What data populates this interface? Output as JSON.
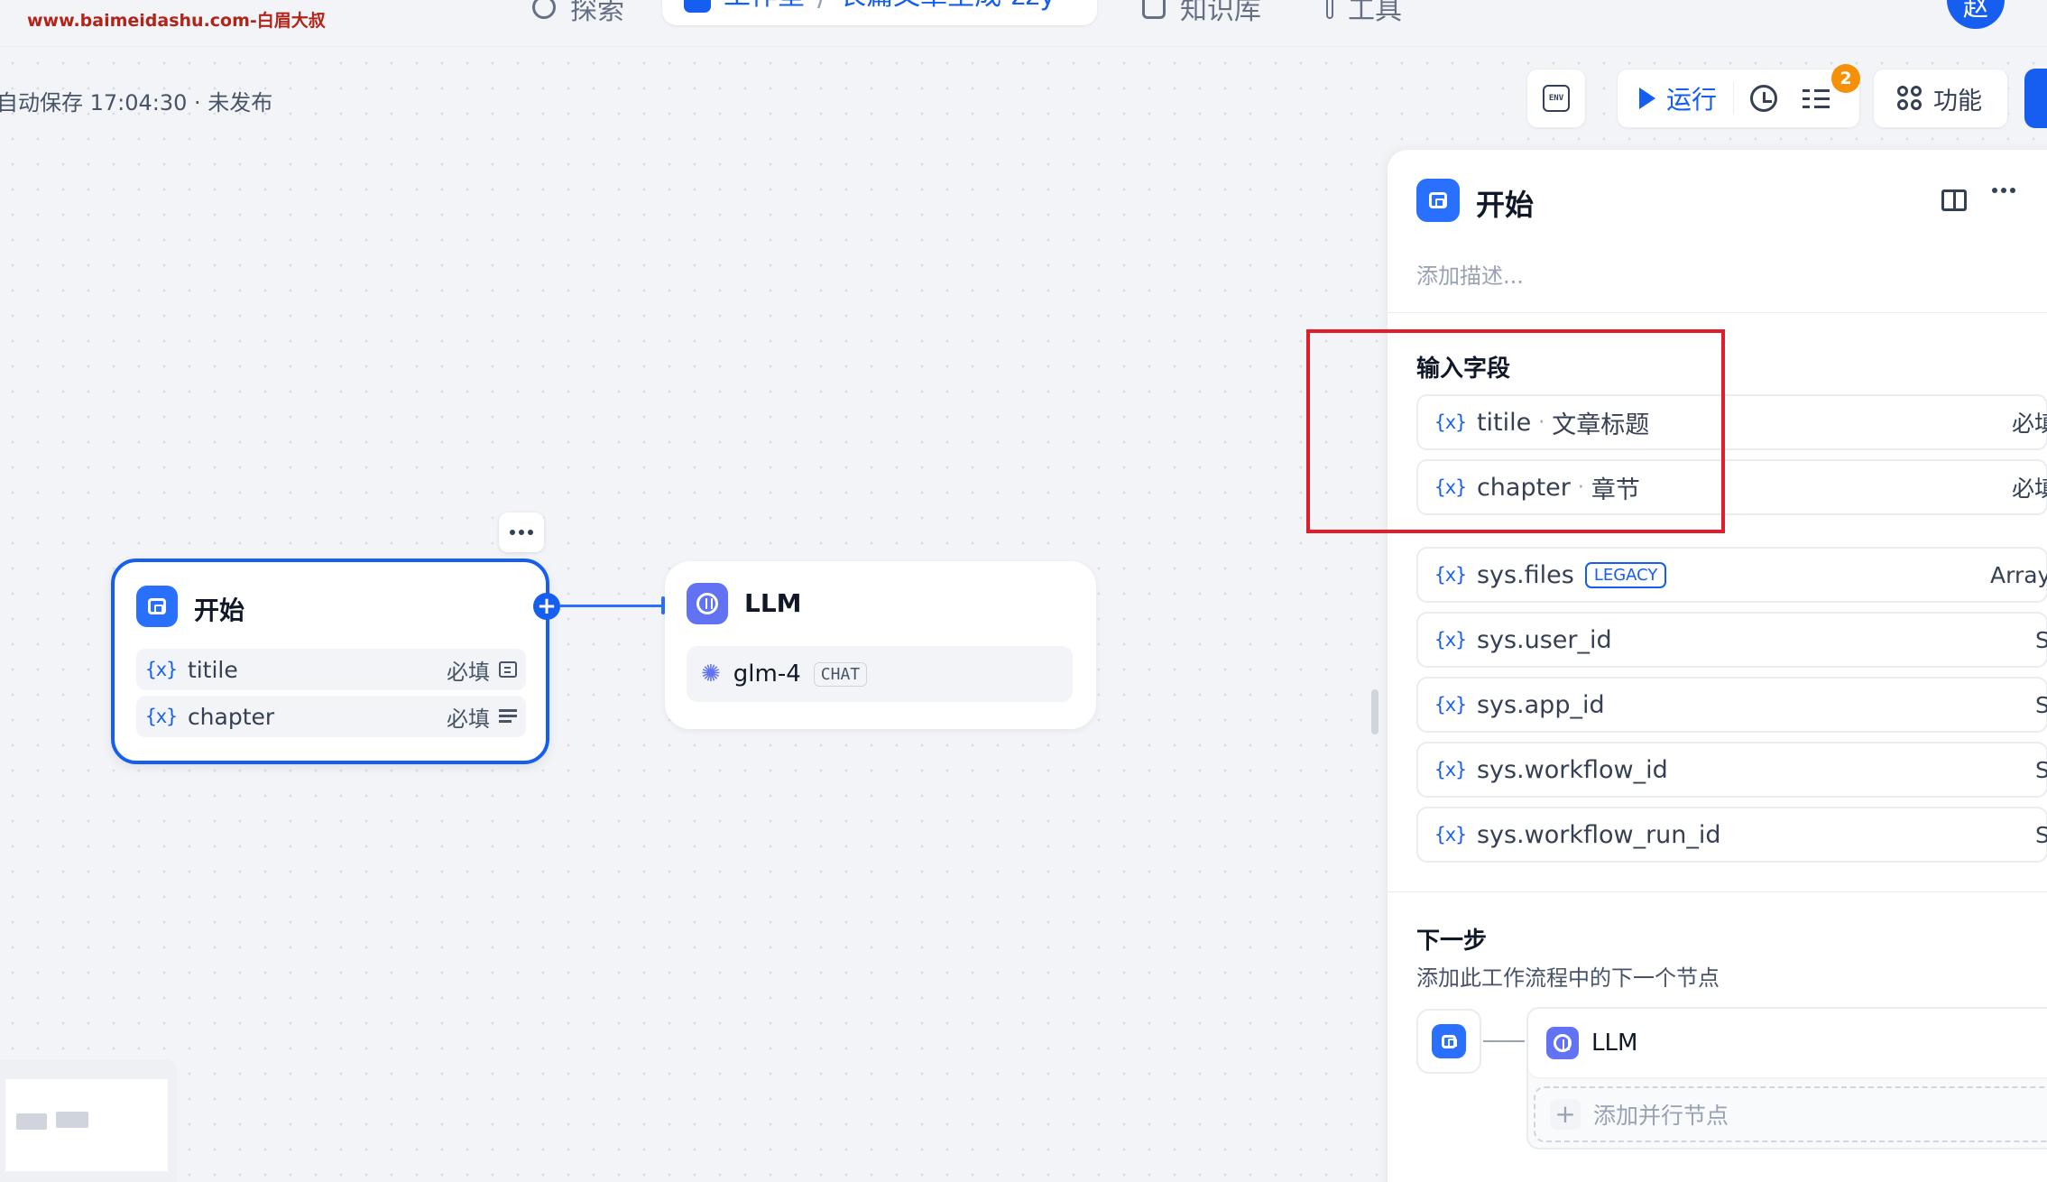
{
  "watermark": "www.baimeidashu.com-白眉大叔",
  "nav": {
    "explore": "探索",
    "studio": "工作室",
    "separator": "/",
    "app_name": "长篇文章生成-zzy",
    "knowledge": "知识库",
    "tools": "工具",
    "user_avatar": "赵"
  },
  "status": {
    "autosave": "自动保存 17:04:30 · 未发布"
  },
  "toolbar": {
    "env": "ENV",
    "run": "运行",
    "checklist_count": "2",
    "features": "功能"
  },
  "canvas": {
    "start_node": {
      "title": "开始",
      "vars": [
        {
          "name": "titile",
          "required": "必填",
          "type": "text"
        },
        {
          "name": "chapter",
          "required": "必填",
          "type": "paragraph"
        }
      ]
    },
    "llm_node": {
      "title": "LLM",
      "model": "glm-4",
      "mode": "CHAT"
    }
  },
  "panel": {
    "title": "开始",
    "description_placeholder": "添加描述...",
    "input_section_title": "输入字段",
    "var_icon": "{x}",
    "input_vars": [
      {
        "name": "titile",
        "label": "文章标题",
        "required": "必填"
      },
      {
        "name": "chapter",
        "label": "章节",
        "required": "必填"
      }
    ],
    "system_vars": [
      {
        "name": "sys.files",
        "tag": "LEGACY",
        "type": "Array[File]"
      },
      {
        "name": "sys.user_id",
        "type": "String"
      },
      {
        "name": "sys.app_id",
        "type": "String"
      },
      {
        "name": "sys.workflow_id",
        "type": "String"
      },
      {
        "name": "sys.workflow_run_id",
        "type": "String"
      }
    ],
    "next_step": {
      "title": "下一步",
      "subtitle": "添加此工作流程中的下一个节点",
      "next_node": "LLM",
      "add_parallel": "添加并行节点"
    }
  },
  "colors": {
    "primary": "#155eef",
    "highlight_border": "#e11d2a",
    "badge": "#f79009",
    "llm_icon": "#6172f3"
  }
}
